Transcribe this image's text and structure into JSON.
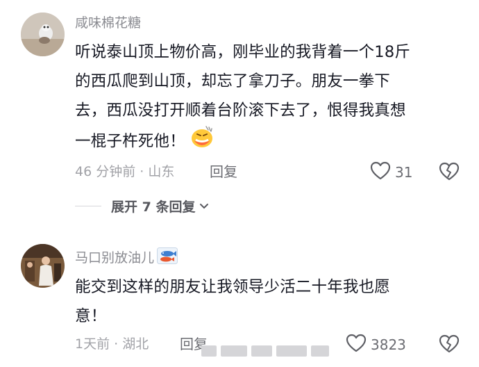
{
  "comments": [
    {
      "username": "咸味棉花糖",
      "lines": [
        "听说泰山顶上物价高，刚毕业的我背着一个18斤",
        "的西瓜爬到山顶，却忘了拿刀子。朋友一拳下",
        "去，西瓜没打开顺着台阶滚下去了，恨得我真想",
        "一棍子杵死他！"
      ],
      "emoji_icon": "grimacing-face-icon",
      "time": "46 分钟前",
      "location": "山东",
      "meta_separator": " · ",
      "reply_label": "回复",
      "likes": "31",
      "expand_label": "展开 7 条回复"
    },
    {
      "username": "马口别放油儿",
      "badge_icon": "fish-kite-badge-icon",
      "lines": [
        "能交到这样的朋友让我领导少活二十年我也愿",
        "意！"
      ],
      "time": "1天前",
      "location": "湖北",
      "meta_separator": " · ",
      "reply_label": "回复",
      "likes": "3823"
    }
  ],
  "colors": {
    "text": "#161823",
    "muted": "#8a8b91",
    "meta": "#a1a2a7"
  }
}
